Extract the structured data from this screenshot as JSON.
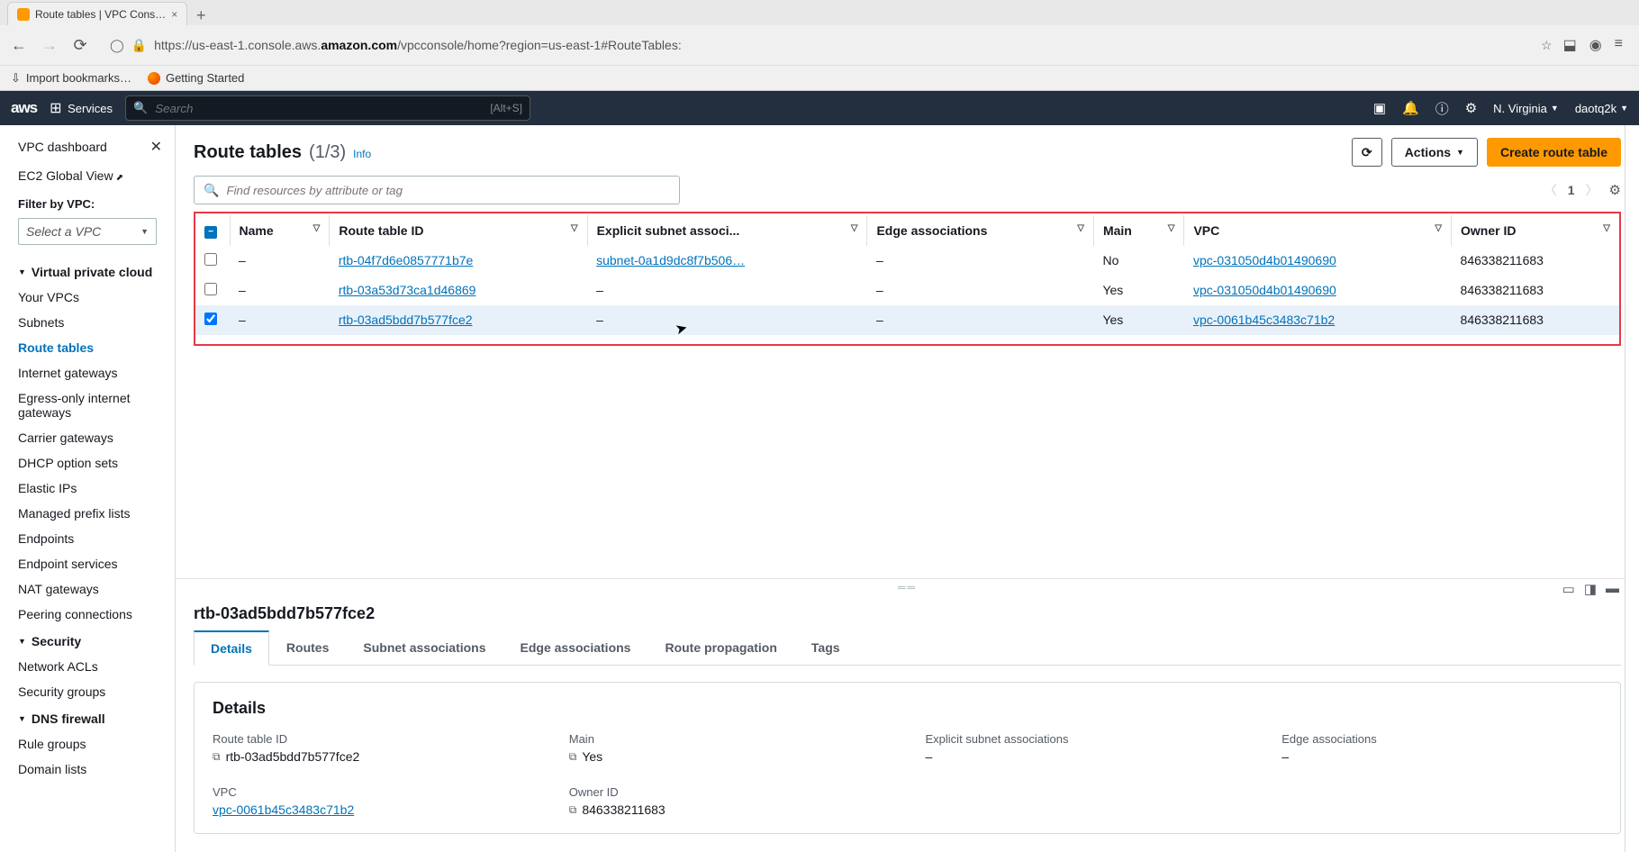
{
  "browser": {
    "tab_title": "Route tables | VPC Cons…",
    "url_prefix": "https://us-east-1.console.aws.",
    "url_bold": "amazon.com",
    "url_suffix": "/vpcconsole/home?region=us-east-1#RouteTables:",
    "bm_import": "Import bookmarks…",
    "bm_start": "Getting Started"
  },
  "header": {
    "logo": "aws",
    "services": "Services",
    "search_placeholder": "Search",
    "search_kbd": "[Alt+S]",
    "region": "N. Virginia",
    "user": "daotq2k"
  },
  "sidebar": {
    "dashboard": "VPC dashboard",
    "ec2_global": "EC2 Global View",
    "filter_label": "Filter by VPC:",
    "filter_placeholder": "Select a VPC",
    "sections": [
      {
        "title": "Virtual private cloud",
        "items": [
          "Your VPCs",
          "Subnets",
          "Route tables",
          "Internet gateways",
          "Egress-only internet gateways",
          "Carrier gateways",
          "DHCP option sets",
          "Elastic IPs",
          "Managed prefix lists",
          "Endpoints",
          "Endpoint services",
          "NAT gateways",
          "Peering connections"
        ],
        "active": "Route tables"
      },
      {
        "title": "Security",
        "items": [
          "Network ACLs",
          "Security groups"
        ]
      },
      {
        "title": "DNS firewall",
        "items": [
          "Rule groups",
          "Domain lists"
        ]
      }
    ]
  },
  "main": {
    "heading": "Route tables",
    "count": "(1/3)",
    "info": "Info",
    "actions_btn": "Actions",
    "create_btn": "Create route table",
    "filter_placeholder": "Find resources by attribute or tag",
    "page_num": "1"
  },
  "table": {
    "columns": [
      "Name",
      "Route table ID",
      "Explicit subnet associ...",
      "Edge associations",
      "Main",
      "VPC",
      "Owner ID"
    ],
    "rows": [
      {
        "checked": false,
        "name": "–",
        "rtb": "rtb-04f7d6e0857771b7e",
        "subnet": "subnet-0a1d9dc8f7b506…",
        "edge": "–",
        "main": "No",
        "vpc": "vpc-031050d4b01490690",
        "owner": "846338211683"
      },
      {
        "checked": false,
        "name": "–",
        "rtb": "rtb-03a53d73ca1d46869",
        "subnet": "–",
        "edge": "–",
        "main": "Yes",
        "vpc": "vpc-031050d4b01490690",
        "owner": "846338211683"
      },
      {
        "checked": true,
        "name": "–",
        "rtb": "rtb-03ad5bdd7b577fce2",
        "subnet": "–",
        "edge": "–",
        "main": "Yes",
        "vpc": "vpc-0061b45c3483c71b2",
        "owner": "846338211683"
      }
    ]
  },
  "details": {
    "selected_id": "rtb-03ad5bdd7b577fce2",
    "tabs": [
      "Details",
      "Routes",
      "Subnet associations",
      "Edge associations",
      "Route propagation",
      "Tags"
    ],
    "active_tab": "Details",
    "heading": "Details",
    "fields": {
      "rtb_label": "Route table ID",
      "rtb_val": "rtb-03ad5bdd7b577fce2",
      "main_label": "Main",
      "main_val": "Yes",
      "expl_label": "Explicit subnet associations",
      "expl_val": "–",
      "edge_label": "Edge associations",
      "edge_val": "–",
      "vpc_label": "VPC",
      "vpc_val": "vpc-0061b45c3483c71b2",
      "owner_label": "Owner ID",
      "owner_val": "846338211683"
    }
  }
}
